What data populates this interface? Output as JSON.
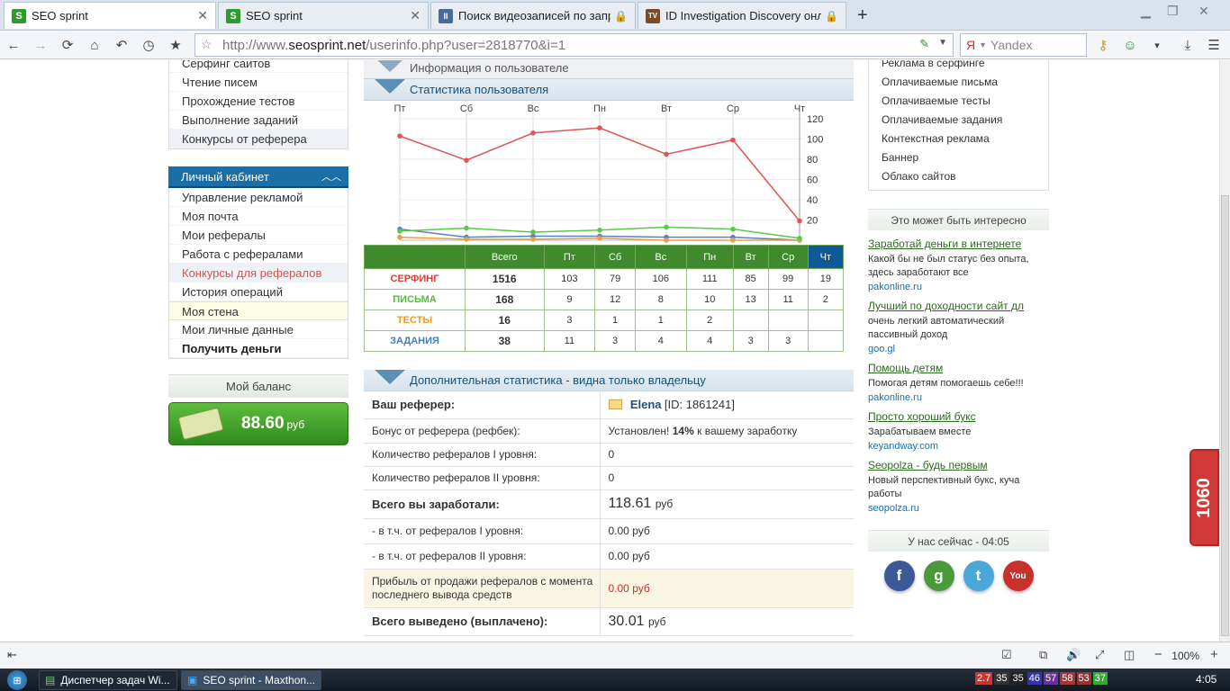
{
  "tabs": [
    {
      "title": "SEO sprint",
      "icon": "S",
      "active": true
    },
    {
      "title": "SEO sprint",
      "icon": "S",
      "active": false
    },
    {
      "title": "Поиск видеозаписей по запро...",
      "icon": "II",
      "active": false
    },
    {
      "title": "ID Investigation Discovery онла...",
      "icon": "TV",
      "active": false
    }
  ],
  "address": {
    "prefix": "http://www.",
    "domain": "seosprint.net",
    "path": "/userinfo.php?user=2818770&i=1"
  },
  "search_placeholder": "Yandex",
  "left": {
    "top_menu": [
      "Серфинг сайтов",
      "Чтение писем",
      "Прохождение тестов",
      "Выполнение заданий",
      "Конкурсы от реферера"
    ],
    "cabinet_title": "Личный кабинет",
    "cabinet_menu": [
      "Управление рекламой",
      "Моя почта",
      "Мои рефералы",
      "Работа с рефералами",
      "Конкурсы для рефералов",
      "История операций",
      "Моя стена",
      "Мои личные данные",
      "Получить деньги"
    ],
    "balance_title": "Мой баланс",
    "balance_amount": "88.60",
    "balance_currency": "руб"
  },
  "center": {
    "info_title": "Информация о пользователе",
    "stats_title": "Статистика пользователя",
    "extra_title": "Дополнительная статистика - видна только владельцу",
    "table_header": [
      "",
      "Всего",
      "Пт",
      "Сб",
      "Вс",
      "Пн",
      "Вт",
      "Ср",
      "Чт"
    ],
    "table_rows": [
      {
        "label": "СЕРФИНГ",
        "color": "#d9403a",
        "total": "1516",
        "days": [
          "103",
          "79",
          "106",
          "111",
          "85",
          "99",
          "19"
        ]
      },
      {
        "label": "ПИСЬМА",
        "color": "#4fbf2f",
        "total": "168",
        "days": [
          "9",
          "12",
          "8",
          "10",
          "13",
          "11",
          "2"
        ]
      },
      {
        "label": "ТЕСТЫ",
        "color": "#e89a2c",
        "total": "16",
        "days": [
          "3",
          "1",
          "1",
          "2",
          "",
          "",
          ""
        ]
      },
      {
        "label": "ЗАДАНИЯ",
        "color": "#3f7fc0",
        "total": "38",
        "days": [
          "11",
          "3",
          "4",
          "4",
          "3",
          "3",
          ""
        ]
      }
    ],
    "info_rows": [
      {
        "k": "Ваш реферер:",
        "v": "Elena",
        "v2": "[ID: 1861241]"
      },
      {
        "k": "Бонус от реферера (рефбек):",
        "v": "Установлен!",
        "v2": "14%",
        "v3": "к вашему заработку"
      },
      {
        "k": "Количество рефералов I уровня:",
        "v": "0"
      },
      {
        "k": "Количество рефералов II уровня:",
        "v": "0"
      },
      {
        "k": "Всего вы заработали:",
        "v": "118.61",
        "cur": "руб"
      },
      {
        "k": "- в т.ч. от рефералов I уровня:",
        "v": "0.00 руб"
      },
      {
        "k": "- в т.ч. от рефералов II уровня:",
        "v": "0.00 руб"
      },
      {
        "k": "Прибыль от продажи рефералов с момента последнего вывода средств",
        "v": "0.00 руб"
      },
      {
        "k": "Всего выведено (выплачено):",
        "v": "30.01",
        "cur": "руб"
      }
    ]
  },
  "chart_data": {
    "type": "line",
    "categories": [
      "Пт",
      "Сб",
      "Вс",
      "Пн",
      "Вт",
      "Ср",
      "Чт"
    ],
    "series": [
      {
        "color": "#e05555",
        "values": [
          103,
          79,
          106,
          111,
          85,
          99,
          19
        ]
      },
      {
        "color": "#5cc84a",
        "values": [
          9,
          12,
          8,
          10,
          13,
          11,
          2
        ]
      },
      {
        "color": "#e8a040",
        "values": [
          3,
          1,
          1,
          2,
          0,
          0,
          0
        ]
      },
      {
        "color": "#5a7fc9",
        "values": [
          11,
          3,
          4,
          4,
          3,
          3,
          0
        ]
      }
    ],
    "y_ticks": [
      "20",
      "40",
      "60",
      "80",
      "100",
      "120"
    ],
    "ylim": [
      0,
      120
    ],
    "y_axis_side": "right",
    "grid": true
  },
  "right": {
    "menu": [
      "Реклама в серфинге",
      "Оплачиваемые письма",
      "Оплачиваемые тесты",
      "Оплачиваемые задания",
      "Контекстная реклама",
      "Баннер",
      "Облако сайтов"
    ],
    "interesting_title": "Это может быть интересно",
    "ads": [
      {
        "t": "Заработай деньги в интернете",
        "d": "Какой бы не был статус без опыта, здесь заработают все",
        "s": "pakonline.ru"
      },
      {
        "t": "Лучший по доходности сайт дл",
        "d": "очень легкий автоматический пассивный доход",
        "s": "goo.gl"
      },
      {
        "t": "Помощь детям",
        "d": "Помогая детям помогаешь себе!!!",
        "s": "pakonline.ru"
      },
      {
        "t": "Просто хороший букс",
        "d": "Зарабатываем вместе",
        "s": "keyandway.com"
      },
      {
        "t": "Seopolza - будь первым",
        "d": "Новый перспективный букс, куча работы",
        "s": "seopolza.ru"
      }
    ],
    "now_title": "У нас сейчас - 04:05",
    "social": [
      {
        "n": "facebook-icon",
        "l": "f",
        "c": "#3b5998"
      },
      {
        "n": "google-icon",
        "l": "g",
        "c": "#4a9a3a"
      },
      {
        "n": "twitter-icon",
        "l": "t",
        "c": "#4aa8d8"
      },
      {
        "n": "youtube-icon",
        "l": "You",
        "c": "#c8302a"
      }
    ]
  },
  "widget_label": "1060",
  "zoom": "100%",
  "taskbar": {
    "items": [
      "Диспетчер задач Wi...",
      "SEO sprint - Maxthon..."
    ],
    "tray": [
      "2.7",
      "35",
      "35",
      "46",
      "57",
      "58",
      "53",
      "37"
    ],
    "clock": "4:05"
  }
}
